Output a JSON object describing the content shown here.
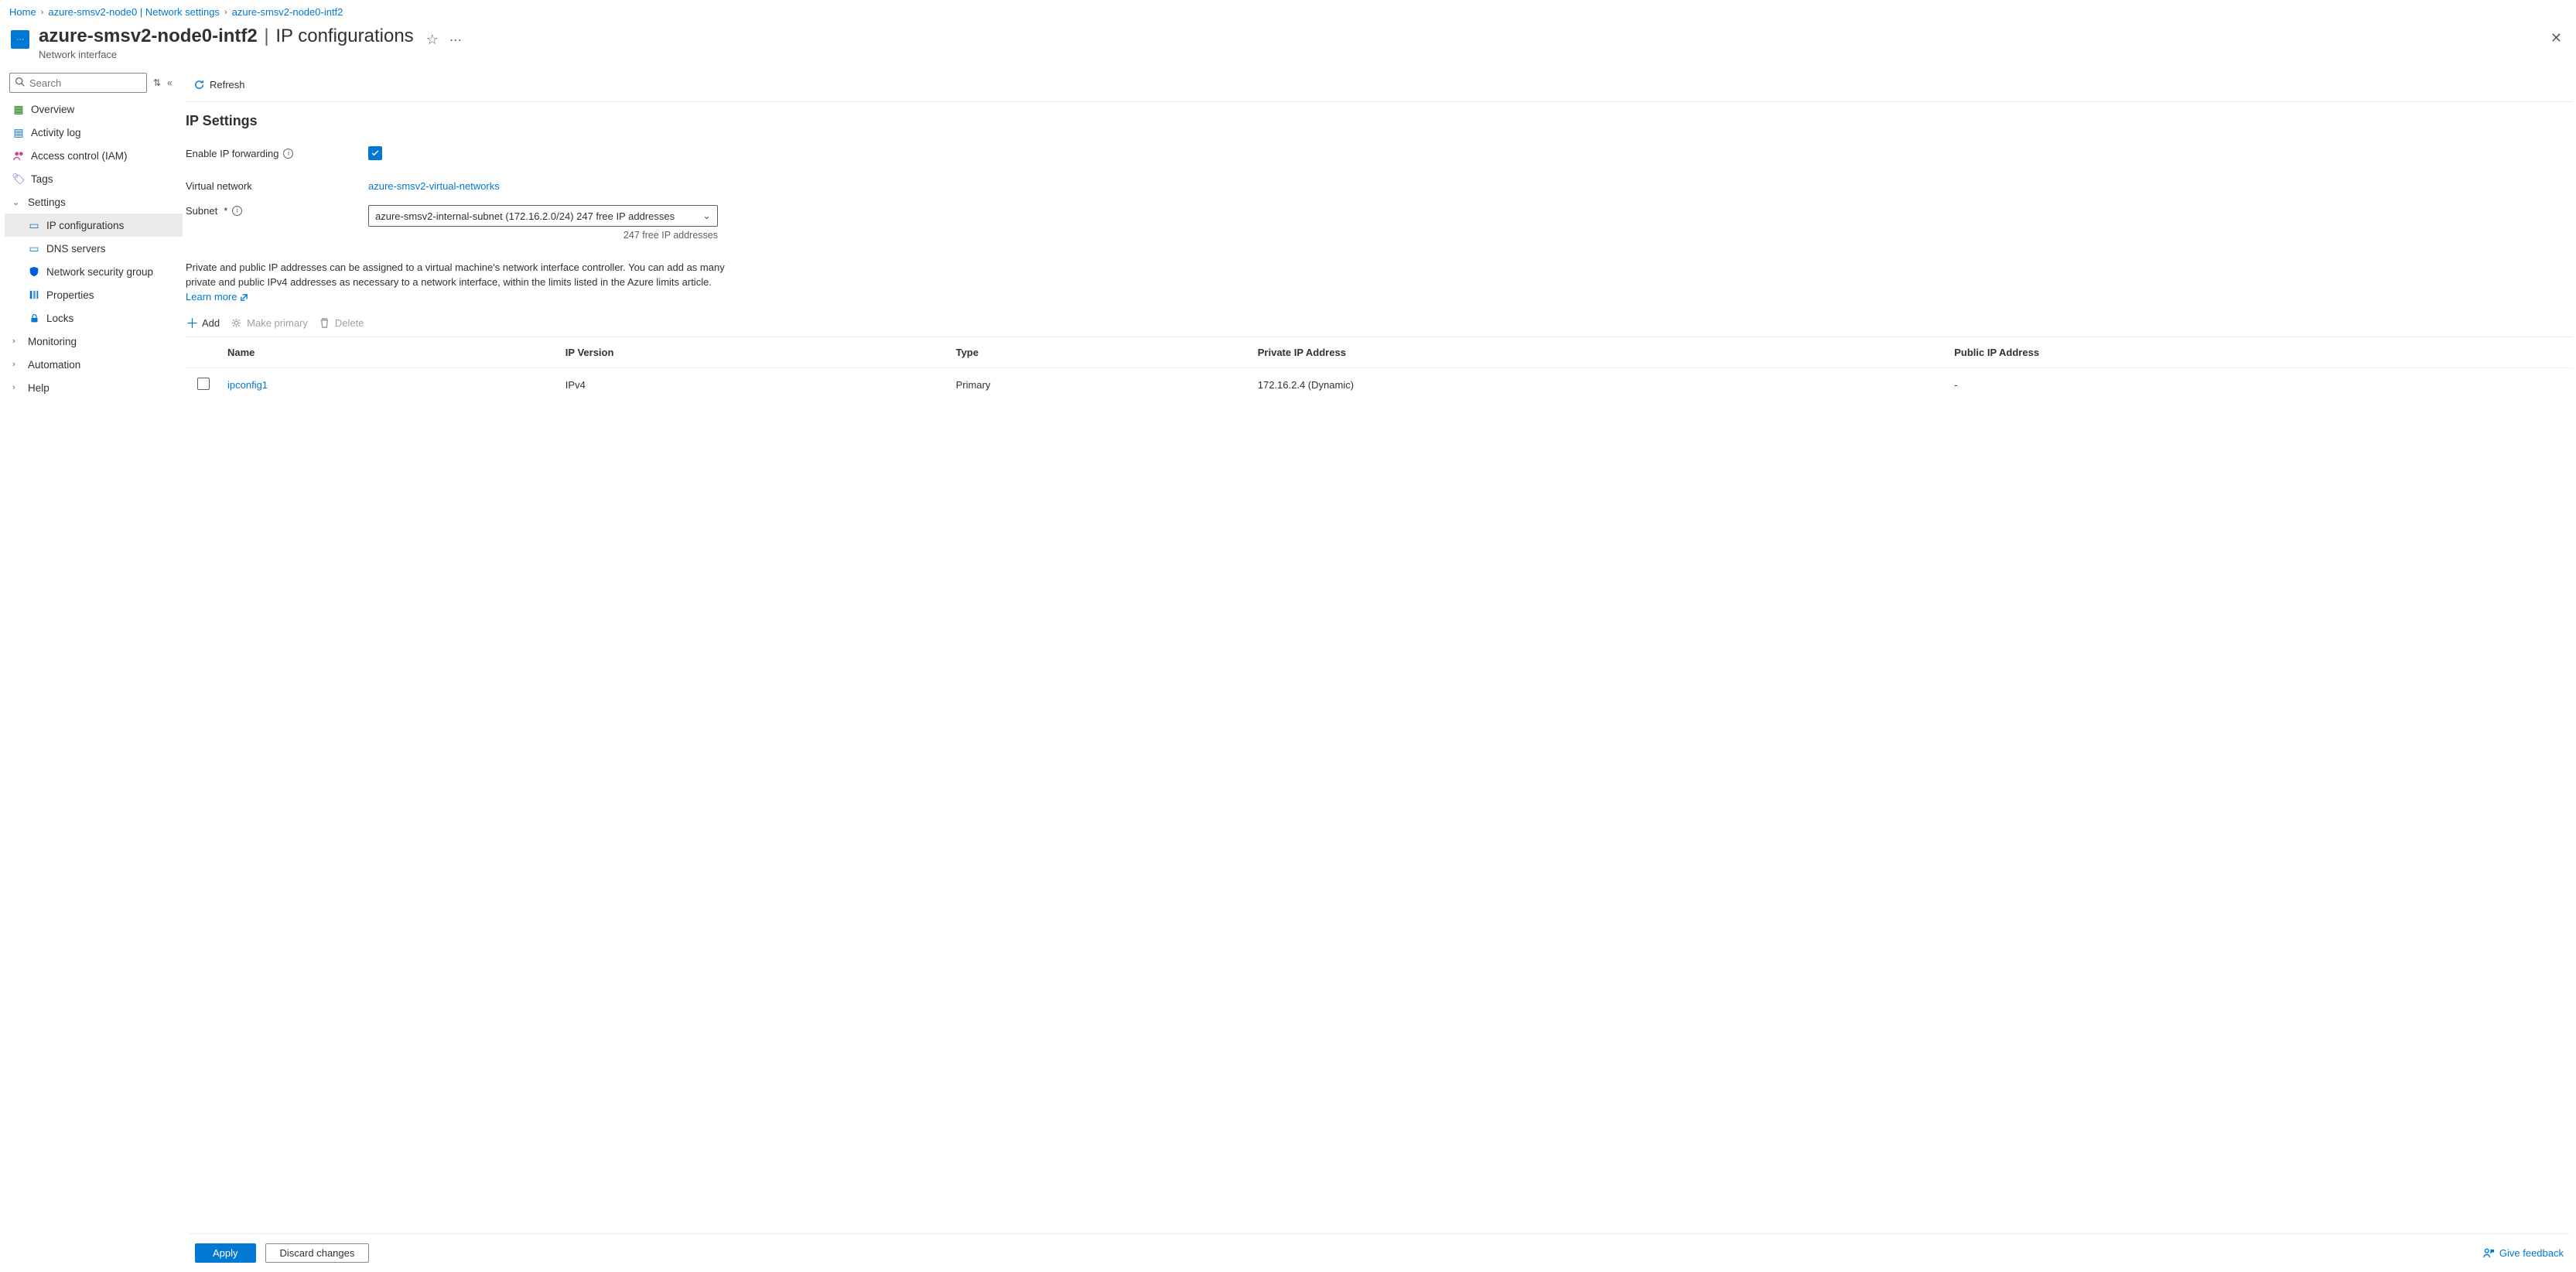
{
  "breadcrumb": {
    "items": [
      {
        "label": "Home"
      },
      {
        "label": "azure-smsv2-node0 | Network settings"
      },
      {
        "label": "azure-smsv2-node0-intf2"
      }
    ]
  },
  "header": {
    "resource_name": "azure-smsv2-node0-intf2",
    "page_section": "IP configurations",
    "subtitle": "Network interface"
  },
  "search": {
    "placeholder": "Search"
  },
  "sidebar": {
    "overview": "Overview",
    "activity_log": "Activity log",
    "access_control": "Access control (IAM)",
    "tags": "Tags",
    "settings_group": "Settings",
    "settings": {
      "ip_configurations": "IP configurations",
      "dns_servers": "DNS servers",
      "nsg": "Network security group",
      "properties": "Properties",
      "locks": "Locks"
    },
    "monitoring_group": "Monitoring",
    "automation_group": "Automation",
    "help_group": "Help"
  },
  "toolbar": {
    "refresh": "Refresh"
  },
  "ip_settings": {
    "title": "IP Settings",
    "enable_ip_forwarding_label": "Enable IP forwarding",
    "enable_ip_forwarding_checked": true,
    "virtual_network_label": "Virtual network",
    "virtual_network_value": "azure-smsv2-virtual-networks",
    "subnet_label": "Subnet",
    "subnet_value": "azure-smsv2-internal-subnet (172.16.2.0/24) 247 free IP addresses",
    "subnet_hint": "247 free IP addresses",
    "description": "Private and public IP addresses can be assigned to a virtual machine's network interface controller. You can add as many private and public IPv4 addresses as necessary to a network interface, within the limits listed in the Azure limits article.",
    "learn_more": "Learn more"
  },
  "actions": {
    "add": "Add",
    "make_primary": "Make primary",
    "delete": "Delete"
  },
  "table": {
    "columns": {
      "name": "Name",
      "ip_version": "IP Version",
      "type": "Type",
      "private_ip": "Private IP Address",
      "public_ip": "Public IP Address"
    },
    "rows": [
      {
        "name": "ipconfig1",
        "ip_version": "IPv4",
        "type": "Primary",
        "private_ip": "172.16.2.4 (Dynamic)",
        "public_ip": "-"
      }
    ]
  },
  "footer": {
    "apply": "Apply",
    "discard": "Discard changes",
    "give_feedback": "Give feedback"
  }
}
